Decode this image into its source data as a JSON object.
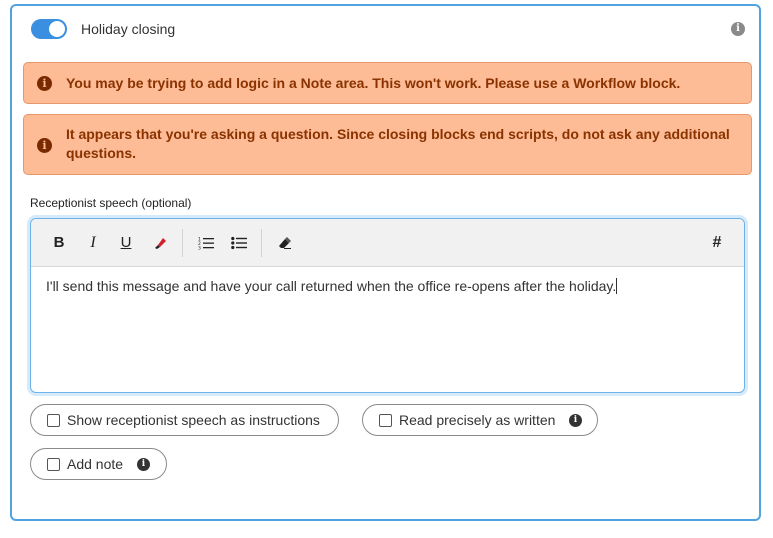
{
  "header": {
    "toggle_on": true,
    "title": "Holiday closing",
    "info_icon": "info-icon"
  },
  "warnings": [
    {
      "icon": "info-icon",
      "text": "You may be trying to add logic in a Note area. This won't work. Please use a Workflow block."
    },
    {
      "icon": "info-icon",
      "text": "It appears that you're asking a question. Since closing blocks end scripts, do not ask any additional questions."
    }
  ],
  "speech": {
    "label": "Receptionist speech (optional)",
    "text": "I'll send this message and have your call returned when the office re-opens after the holiday.",
    "toolbar": {
      "bold": "B",
      "italic": "I",
      "underline": "U",
      "highlight_icon": "marker-icon",
      "ordered_list_icon": "ordered-list-icon",
      "bullet_list_icon": "bullet-list-icon",
      "eraser_icon": "eraser-icon",
      "variable": "#"
    }
  },
  "options": {
    "show_instructions": {
      "label": "Show receptionist speech as instructions",
      "checked": false
    },
    "read_precisely": {
      "label": "Read precisely as written",
      "checked": false,
      "info_icon": "info-icon"
    },
    "add_note": {
      "label": "Add note",
      "checked": false,
      "info_icon": "info-icon"
    }
  },
  "colors": {
    "accent": "#3b8fe0",
    "warning_bg": "#fdbc96",
    "warning_text": "#8a3200"
  }
}
